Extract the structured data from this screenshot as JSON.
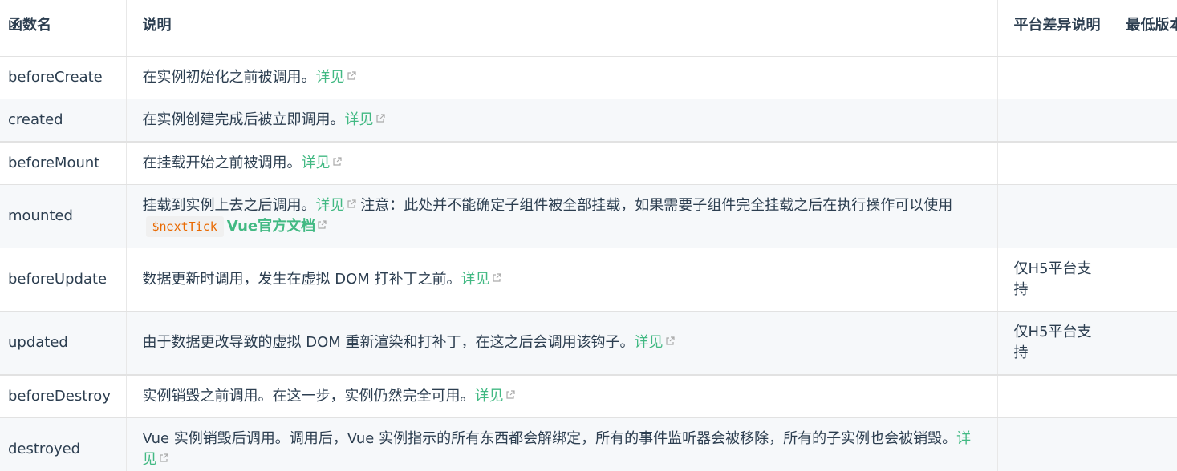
{
  "headers": [
    "函数名",
    "说明",
    "平台差异说明",
    "最低版本"
  ],
  "see_label": "详见",
  "rows": [
    {
      "name": "beforeCreate",
      "desc": "在实例初始化之前被调用。",
      "platform": "",
      "version": ""
    },
    {
      "name": "created",
      "desc": "在实例创建完成后被立即调用。",
      "platform": "",
      "version": ""
    },
    {
      "name": "beforeMount",
      "desc": "在挂载开始之前被调用。",
      "platform": "",
      "version": ""
    },
    {
      "name": "mounted",
      "desc": "挂载到实例上去之后调用。",
      "note": "注意：此处并不能确定子组件被全部挂载，如果需要子组件完全挂载之后在执行操作可以使用",
      "code": "$nextTick",
      "doc_link": "Vue官方文档",
      "platform": "",
      "version": ""
    },
    {
      "name": "beforeUpdate",
      "desc": "数据更新时调用，发生在虚拟 DOM 打补丁之前。",
      "platform": "仅H5平台支持",
      "version": ""
    },
    {
      "name": "updated",
      "desc": "由于数据更改导致的虚拟 DOM 重新渲染和打补丁，在这之后会调用该钩子。",
      "platform": "仅H5平台支持",
      "version": ""
    },
    {
      "name": "beforeDestroy",
      "desc": "实例销毁之前调用。在这一步，实例仍然完全可用。",
      "platform": "",
      "version": ""
    },
    {
      "name": "destroyed",
      "desc": "Vue 实例销毁后调用。调用后，Vue 实例指示的所有东西都会解绑定，所有的事件监听器会被移除，所有的子实例也会被销毁。",
      "platform": "",
      "version": ""
    }
  ],
  "colors": {
    "link": "#42b983",
    "code": "#e96900",
    "stripe": "#f6f8fa",
    "text": "#2c3e50"
  }
}
